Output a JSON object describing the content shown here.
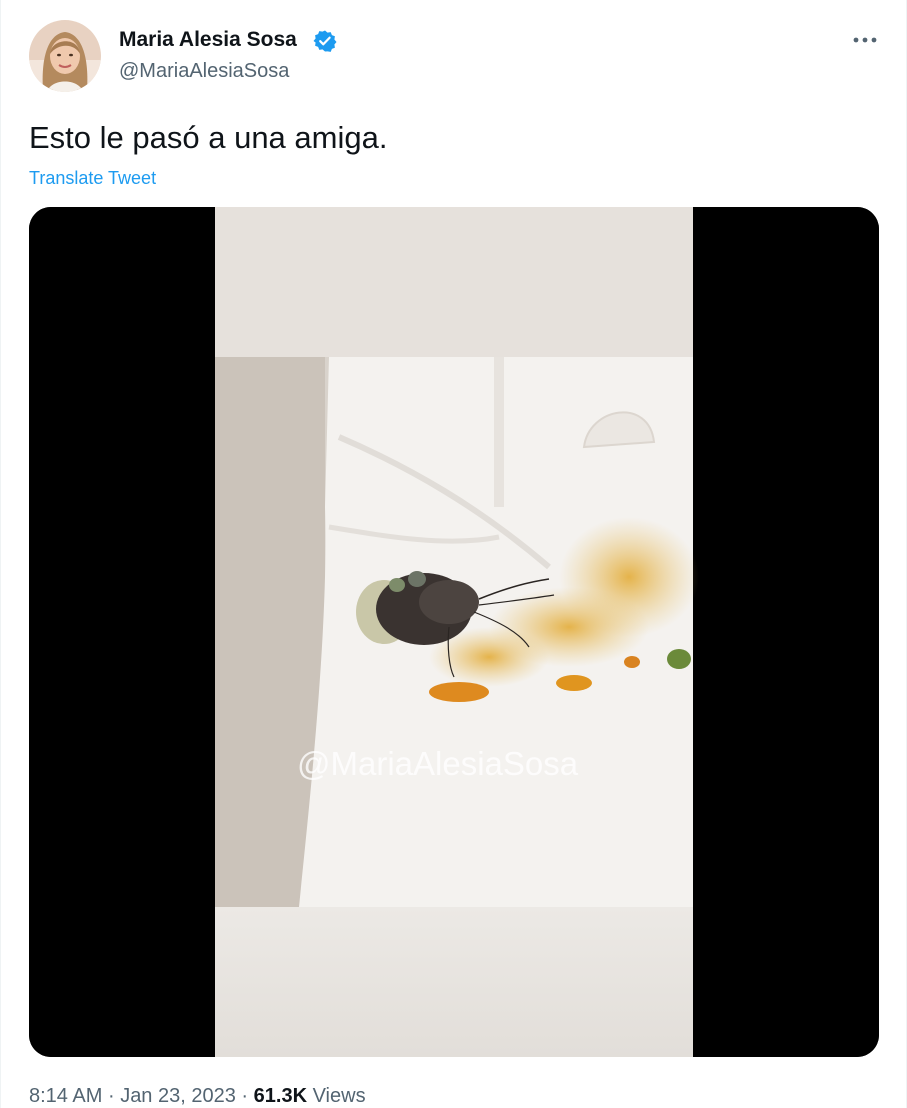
{
  "user": {
    "display_name": "Maria Alesia Sosa",
    "handle": "@MariaAlesiaSosa",
    "verified": true,
    "verified_color": "#1d9bf0"
  },
  "tweet": {
    "text": "Esto le pasó a una amiga.",
    "translate_label": "Translate Tweet",
    "media_watermark": "@MariaAlesiaSosa",
    "time": "8:14 AM",
    "date": "Jan 23, 2023",
    "separator": "·",
    "views_count": "61.3K",
    "views_label": "Views"
  },
  "icons": {
    "more": "more-horizontal-icon",
    "verified": "verified-badge-icon"
  },
  "colors": {
    "link": "#1d9bf0",
    "secondary_text": "#536471",
    "primary_text": "#0f1419"
  }
}
